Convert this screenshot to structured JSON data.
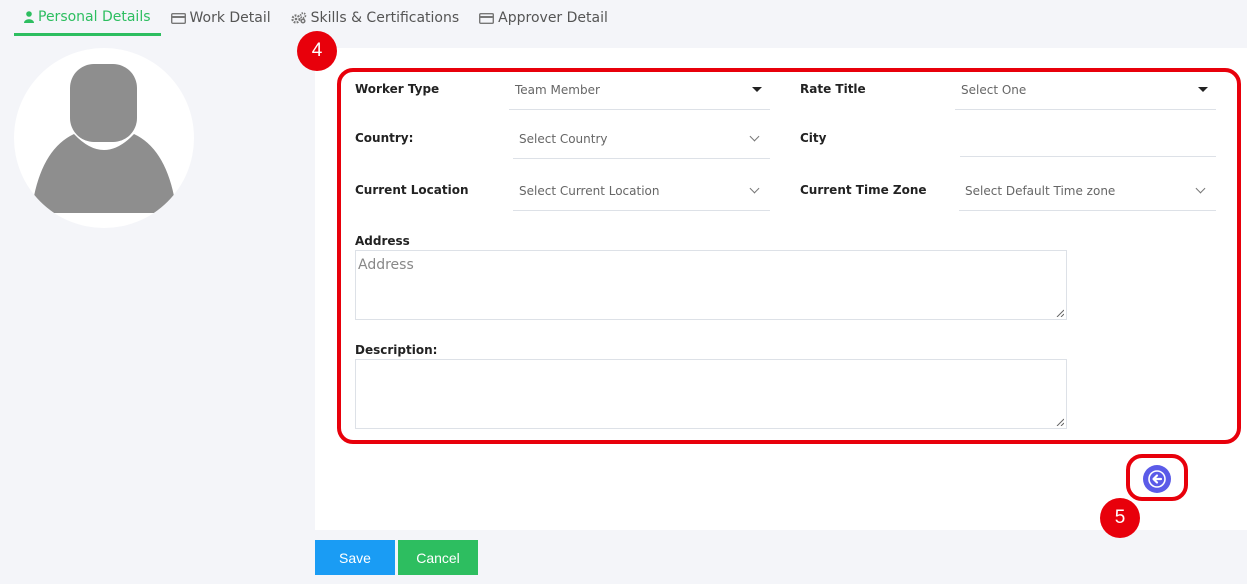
{
  "tabs": [
    {
      "label": "Personal Details",
      "icon": "user-icon",
      "active": true
    },
    {
      "label": "Work Detail",
      "icon": "card-icon"
    },
    {
      "label": "Skills & Certifications",
      "icon": "gears-icon"
    },
    {
      "label": "Approver Detail",
      "icon": "card-icon"
    }
  ],
  "annotations": {
    "form_marker": "4",
    "back_marker": "5",
    "highlight_color": "#e8000b"
  },
  "form": {
    "worker_type": {
      "label": "Worker Type",
      "value": "Team Member"
    },
    "rate_title": {
      "label": "Rate Title",
      "value": "Select One"
    },
    "country": {
      "label": "Country:",
      "value": "Select Country"
    },
    "city": {
      "label": "City",
      "value": ""
    },
    "current_location": {
      "label": "Current Location",
      "value": "Select Current Location"
    },
    "time_zone": {
      "label": "Current Time Zone",
      "value": "Select Default Time zone"
    },
    "address": {
      "label": "Address",
      "placeholder": "Address"
    },
    "description": {
      "label": "Description:",
      "placeholder": ""
    }
  },
  "buttons": {
    "save": "Save",
    "cancel": "Cancel"
  },
  "colors": {
    "active_tab": "#2dbe60",
    "save": "#1a9cf4",
    "cancel": "#2dbe60",
    "back_button": "#5b5be8"
  }
}
